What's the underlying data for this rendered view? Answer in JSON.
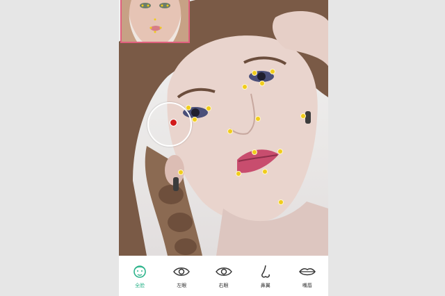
{
  "colors": {
    "accent": "#2bb38a",
    "keypoint": "#f0cc1c",
    "selected_point": "#d21a1a",
    "thumbnail_border": "#e0607e"
  },
  "toolbar": {
    "items": [
      {
        "label": "全脸",
        "icon": "face-icon",
        "active": true
      },
      {
        "label": "左眼",
        "icon": "eye-icon",
        "active": false
      },
      {
        "label": "右眼",
        "icon": "eye-icon",
        "active": false
      },
      {
        "label": "鼻翼",
        "icon": "nose-icon",
        "active": false
      },
      {
        "label": "嘴唇",
        "icon": "lips-icon",
        "active": false
      }
    ]
  }
}
